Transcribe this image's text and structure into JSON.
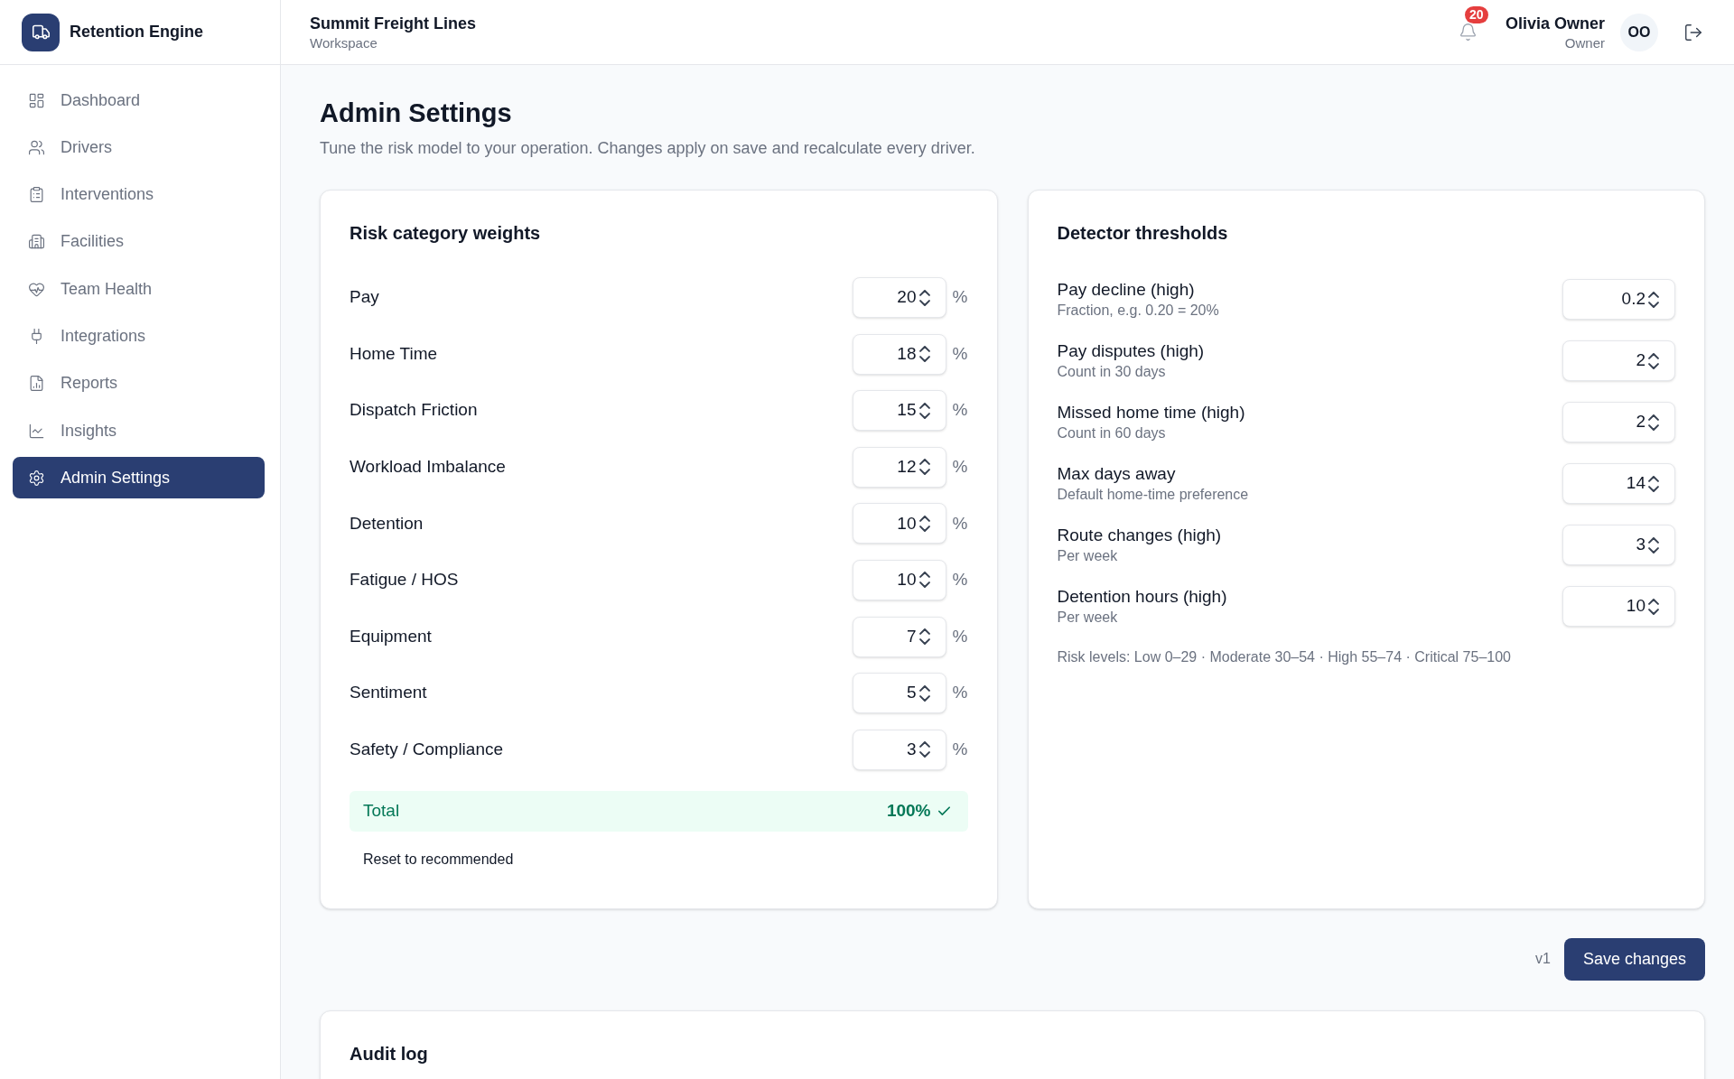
{
  "sidebar": {
    "brand": "Retention Engine",
    "items": [
      {
        "label": "Dashboard",
        "selected": false
      },
      {
        "label": "Drivers",
        "selected": false
      },
      {
        "label": "Interventions",
        "selected": false
      },
      {
        "label": "Facilities",
        "selected": false
      },
      {
        "label": "Team Health",
        "selected": false
      },
      {
        "label": "Integrations",
        "selected": false
      },
      {
        "label": "Reports",
        "selected": false
      },
      {
        "label": "Insights",
        "selected": false
      },
      {
        "label": "Admin Settings",
        "selected": true
      }
    ]
  },
  "header": {
    "workspace": {
      "name": "Summit Freight Lines",
      "label": "Workspace"
    },
    "notifications": {
      "count": "20"
    },
    "user": {
      "name": "Olivia Owner",
      "role": "Owner",
      "initials": "OO"
    }
  },
  "page": {
    "title": "Admin Settings",
    "subtitle": "Tune the risk model to your operation. Changes apply on save and recalculate every driver."
  },
  "weights_card": {
    "title": "Risk category weights",
    "rows": [
      {
        "label": "Pay",
        "value": "20",
        "unit": "%"
      },
      {
        "label": "Home Time",
        "value": "18",
        "unit": "%"
      },
      {
        "label": "Dispatch Friction",
        "value": "15",
        "unit": "%"
      },
      {
        "label": "Workload Imbalance",
        "value": "12",
        "unit": "%"
      },
      {
        "label": "Detention",
        "value": "10",
        "unit": "%"
      },
      {
        "label": "Fatigue / HOS",
        "value": "10",
        "unit": "%"
      },
      {
        "label": "Equipment",
        "value": "7",
        "unit": "%"
      },
      {
        "label": "Sentiment",
        "value": "5",
        "unit": "%"
      },
      {
        "label": "Safety / Compliance",
        "value": "3",
        "unit": "%"
      }
    ],
    "total": {
      "label": "Total",
      "value": "100%",
      "valid": true
    },
    "reset_button": "Reset to recommended"
  },
  "thresholds_card": {
    "title": "Detector thresholds",
    "rows": [
      {
        "label": "Pay decline (high)",
        "hint": "Fraction, e.g. 0.20 = 20%",
        "value": "0.2"
      },
      {
        "label": "Pay disputes (high)",
        "hint": "Count in 30 days",
        "value": "2"
      },
      {
        "label": "Missed home time (high)",
        "hint": "Count in 60 days",
        "value": "2"
      },
      {
        "label": "Max days away",
        "hint": "Default home-time preference",
        "value": "14"
      },
      {
        "label": "Route changes (high)",
        "hint": "Per week",
        "value": "3"
      },
      {
        "label": "Detention hours (high)",
        "hint": "Per week",
        "value": "10"
      }
    ],
    "note": "Risk levels: Low 0–29 · Moderate 30–54 · High 55–74 · Critical 75–100"
  },
  "actions": {
    "version": "v1",
    "save_button": "Save changes"
  },
  "audit_log": {
    "title": "Audit log"
  }
}
